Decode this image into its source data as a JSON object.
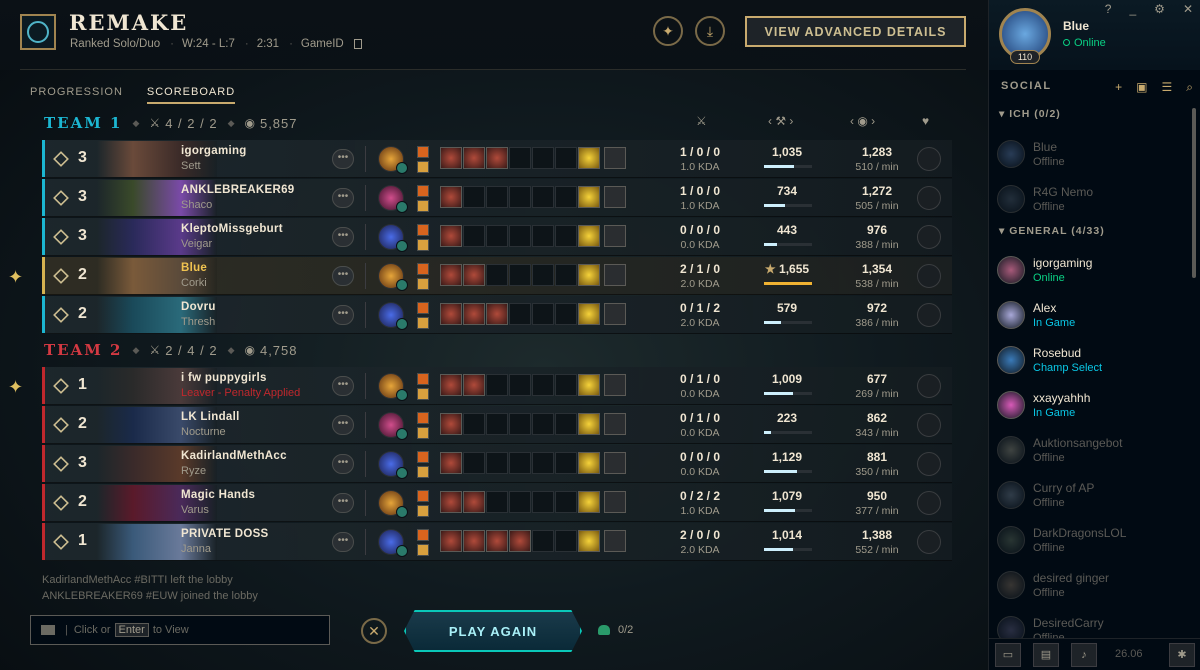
{
  "header": {
    "title": "REMAKE",
    "queue": "Ranked Solo/Duo",
    "record": "W:24 - L:7",
    "duration": "2:31",
    "game_id_label": "GameID",
    "advanced_button": "VIEW ADVANCED DETAILS"
  },
  "tabs": [
    {
      "label": "PROGRESSION",
      "active": false
    },
    {
      "label": "SCOREBOARD",
      "active": true
    }
  ],
  "teams": [
    {
      "name": "TEAM 1",
      "kda": "4 / 2 / 2",
      "gold": "5,857",
      "players": [
        {
          "level": "3",
          "name": "igorgaming",
          "champion": "Sett",
          "kda": "1 / 0 / 0",
          "kda_ratio": "1.0 KDA",
          "damage": "1,035",
          "damage_fill": 0.63,
          "gold": "1,283",
          "gpm": "510 / min",
          "me": false,
          "c1": "#6a4a3a",
          "c2": "#3a2a28",
          "items": 3
        },
        {
          "level": "3",
          "name": "ANKLEBREAKER69",
          "champion": "Shaco",
          "kda": "1 / 0 / 0",
          "kda_ratio": "1.0 KDA",
          "damage": "734",
          "damage_fill": 0.44,
          "gold": "1,272",
          "gpm": "505 / min",
          "me": false,
          "c1": "#3a4a2a",
          "c2": "#7a4aa8",
          "items": 1
        },
        {
          "level": "3",
          "name": "KleptoMissgeburt",
          "champion": "Veigar",
          "kda": "0 / 0 / 0",
          "kda_ratio": "0.0 KDA",
          "damage": "443",
          "damage_fill": 0.27,
          "gold": "976",
          "gpm": "388 / min",
          "me": false,
          "c1": "#2a2a5a",
          "c2": "#5a3a8a",
          "items": 1
        },
        {
          "level": "2",
          "name": "Blue",
          "champion": "Corki",
          "kda": "2 / 1 / 0",
          "kda_ratio": "2.0 KDA",
          "damage": "1,655",
          "damage_star": "★",
          "damage_fill": 1.0,
          "gold": "1,354",
          "gpm": "538 / min",
          "me": true,
          "c1": "#7a5a3a",
          "c2": "#5a4a3a",
          "items": 2
        },
        {
          "level": "2",
          "name": "Dovru",
          "champion": "Thresh",
          "kda": "0 / 1 / 2",
          "kda_ratio": "2.0 KDA",
          "damage": "579",
          "damage_fill": 0.35,
          "gold": "972",
          "gpm": "386 / min",
          "me": false,
          "c1": "#1a4a5a",
          "c2": "#2a6a7a",
          "items": 3
        }
      ]
    },
    {
      "name": "TEAM 2",
      "kda": "2 / 4 / 2",
      "gold": "4,758",
      "players": [
        {
          "level": "1",
          "name": "i fw puppygirls",
          "champion": "Leaver - Penalty Applied",
          "penalty": true,
          "kda": "0 / 1 / 0",
          "kda_ratio": "0.0 KDA",
          "damage": "1,009",
          "damage_fill": 0.61,
          "gold": "677",
          "gpm": "269 / min",
          "me": false,
          "c1": "#2a2a2a",
          "c2": "#4a3a3a",
          "items": 2
        },
        {
          "level": "2",
          "name": "LK Lindall",
          "champion": "Nocturne",
          "kda": "0 / 1 / 0",
          "kda_ratio": "0.0 KDA",
          "damage": "223",
          "damage_fill": 0.14,
          "gold": "862",
          "gpm": "343 / min",
          "me": false,
          "c1": "#1a2a4a",
          "c2": "#3a4a6a",
          "items": 1
        },
        {
          "level": "3",
          "name": "KadirlandMethAcc",
          "champion": "Ryze",
          "kda": "0 / 0 / 0",
          "kda_ratio": "0.0 KDA",
          "damage": "1,129",
          "damage_fill": 0.68,
          "gold": "881",
          "gpm": "350 / min",
          "me": false,
          "c1": "#3a2a2a",
          "c2": "#5a3a2a",
          "items": 1
        },
        {
          "level": "2",
          "name": "Magic Hands",
          "champion": "Varus",
          "kda": "0 / 2 / 2",
          "kda_ratio": "1.0 KDA",
          "damage": "1,079",
          "damage_fill": 0.65,
          "gold": "950",
          "gpm": "377 / min",
          "me": false,
          "c1": "#5a1a2a",
          "c2": "#4a2a5a",
          "items": 2
        },
        {
          "level": "1",
          "name": "PRIVATE DOSS",
          "champion": "Janna",
          "kda": "2 / 0 / 0",
          "kda_ratio": "2.0 KDA",
          "damage": "1,014",
          "damage_fill": 0.61,
          "gold": "1,388",
          "gpm": "552 / min",
          "me": false,
          "c1": "#3a5a7a",
          "c2": "#6a7a9a",
          "items": 4
        }
      ]
    }
  ],
  "chat": {
    "log": [
      "KadirlandMethAcc #BITTI left the lobby",
      "ANKLEBREAKER69 #EUW joined the lobby"
    ],
    "input_prefix": "Click or",
    "input_key": "Enter",
    "input_suffix": "to View"
  },
  "footer": {
    "play_again": "PLAY AGAIN",
    "party": "0/2"
  },
  "social": {
    "me": {
      "name": "Blue",
      "status": "Online",
      "level": "110"
    },
    "title": "SOCIAL",
    "groups": [
      {
        "label": "ICH (0/2)"
      },
      {
        "label": "GENERAL (4/33)"
      }
    ],
    "friends": [
      {
        "name": "Blue",
        "status": "Offline",
        "state": "off",
        "color": "#5a7aa8"
      },
      {
        "name": "R4G Nemo",
        "status": "Offline",
        "state": "off",
        "color": "#4a5a6a"
      },
      {
        "name": "igorgaming",
        "status": "Online",
        "state": "online",
        "color": "#a85a7a"
      },
      {
        "name": "Alex",
        "status": "In Game",
        "state": "game",
        "color": "#a8a8d8"
      },
      {
        "name": "Rosebud",
        "status": "Champ Select",
        "state": "game",
        "color": "#3a7ab8"
      },
      {
        "name": "xxayyahhh",
        "status": "In Game",
        "state": "game",
        "color": "#d85ab8"
      },
      {
        "name": "Auktionsangebot",
        "status": "Offline",
        "state": "off",
        "color": "#8a8a7a"
      },
      {
        "name": "Curry of AP",
        "status": "Offline",
        "state": "off",
        "color": "#6a7a8a"
      },
      {
        "name": "DarkDragonsLOL",
        "status": "Offline",
        "state": "off",
        "color": "#5a6a5a"
      },
      {
        "name": "desired ginger",
        "status": "Offline",
        "state": "off",
        "color": "#7a6a5a"
      },
      {
        "name": "DesiredCarry",
        "status": "Offline",
        "state": "off",
        "color": "#5a5a7a"
      }
    ],
    "clock": "26.06"
  },
  "colors": {
    "gold": "#c8aa6e",
    "team1": "#1cb6d1",
    "team2": "#d33942",
    "online": "#0acf83",
    "ingame": "#0ac8e6"
  }
}
